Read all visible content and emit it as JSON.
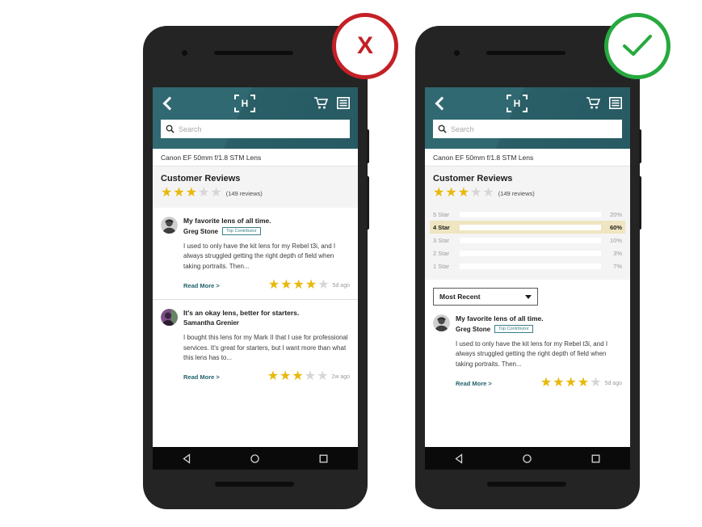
{
  "page": {
    "background": "#ffffff",
    "brand_teal": "#2b616a",
    "gold": "#e8b80b",
    "bad_color": "#c42026",
    "good_color": "#26a93f"
  },
  "badges": {
    "bad": {
      "name": "x-mark",
      "glyph": "X",
      "color": "#c42026"
    },
    "good": {
      "name": "check-mark",
      "glyph": "✓",
      "color": "#26a93f"
    }
  },
  "app": {
    "header": {
      "back_icon": "back-chevron-icon",
      "logo": {
        "letter": "H",
        "name": "brand-logo-icon"
      },
      "cart_icon": "shopping-cart-icon",
      "menu_icon": "hamburger-menu-icon"
    },
    "search": {
      "icon": "search-icon",
      "value": "",
      "placeholder": "Search"
    },
    "product_title": "Canon EF 50mm f/1.8 STM Lens",
    "reviews_section": {
      "heading": "Customer Reviews",
      "aggregate_rating": 3,
      "aggregate_max": 5,
      "count_label": "(149 reviews)"
    },
    "navbar": {
      "back": "nav-back-icon",
      "home": "nav-home-icon",
      "recents": "nav-recents-icon"
    }
  },
  "chart_data": {
    "type": "bar",
    "orientation": "horizontal",
    "title": "Rating distribution",
    "categories": [
      "5 Star",
      "4 Star",
      "3 Star",
      "2 Star",
      "1 Star"
    ],
    "values": [
      20,
      60,
      10,
      3,
      7
    ],
    "value_labels": [
      "20%",
      "60%",
      "10%",
      "3%",
      "7%"
    ],
    "highlighted_index": 1,
    "xlabel": "",
    "ylabel": "",
    "xlim": [
      0,
      100
    ],
    "grid": false,
    "legend": "none",
    "bar_color": "#b4b4b4",
    "highlight_bar_color": "#cea70a",
    "highlight_row_color": "#efe5c0"
  },
  "sort": {
    "label": "Most Recent",
    "caret_icon": "chevron-down-icon"
  },
  "reviews": [
    {
      "title": "My favorite lens of all time.",
      "author": "Greg Stone",
      "badge": "Top Contributor",
      "body": "I used to only have the kit lens for my Rebel t3i, and I always struggled getting the right depth of field when taking portraits. Then...",
      "read_more": "Read More >",
      "rating": 4,
      "time_ago": "5d ago",
      "avatar": "avatar-greg-stone"
    },
    {
      "title": "It's an okay lens, better for starters.",
      "author": "Samantha Grenier",
      "badge": "",
      "body": "I bought this lens for my Mark II that I use for professional services. It's great for starters, but I want more than what this lens has to...",
      "read_more": "Read More >",
      "rating": 3,
      "time_ago": "2w ago",
      "avatar": "avatar-samantha-grenier"
    }
  ]
}
